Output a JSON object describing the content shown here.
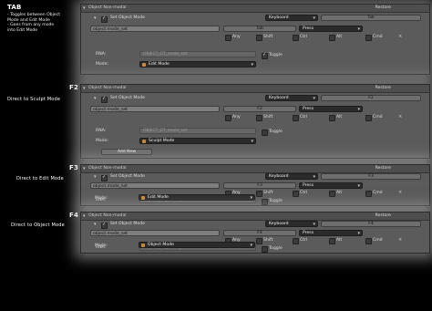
{
  "sections": [
    {
      "title": "TAB",
      "description": [
        "- Toggles between Object",
        "  Mode and Edit Mode",
        "- Goes from any mode",
        "  into Edit Mode"
      ],
      "km_title": "Object Non-modal",
      "restore": "Restore",
      "item_name": "Set Object Mode",
      "input_type": "Keyboard",
      "key": "Tab",
      "operator": "object.mode_set",
      "key_field": "Tab",
      "event": "Press",
      "modifiers": [
        "Any",
        "Shift",
        "Ctrl",
        "Alt",
        "Cmd"
      ],
      "rna_label": "RNA:",
      "rna_value": "OBJECT_OT_mode_set",
      "mode_label": "Mode:",
      "mode_value": "Edit Mode",
      "toggle_label": "Toggle",
      "toggle_checked": true,
      "add_new": ""
    },
    {
      "title": "F2",
      "subtitle": "Direct to Sculpt Mode",
      "km_title": "Object Non-modal",
      "restore": "Restore",
      "item_name": "Set Object Mode",
      "input_type": "Keyboard",
      "key": "F2",
      "operator": "object.mode_set",
      "key_field": "F2",
      "event": "Press",
      "modifiers": [
        "Any",
        "Shift",
        "Ctrl",
        "Alt",
        "Cmd"
      ],
      "rna_label": "RNA:",
      "rna_value": "OBJECT_OT_mode_set",
      "mode_label": "Mode:",
      "mode_value": "Sculpt Mode",
      "toggle_label": "Toggle",
      "toggle_checked": false,
      "add_new": "Add New"
    },
    {
      "title": "F3",
      "subtitle": "Direct to Edit Mode",
      "km_title": "Object Non-modal",
      "restore": "Restore",
      "item_name": "Set Object Mode",
      "input_type": "Keyboard",
      "key": "F3",
      "operator": "object.mode_set",
      "key_field": "F3",
      "event": "Press",
      "modifiers": [
        "Any",
        "Shift",
        "Ctrl",
        "Alt",
        "Cmd"
      ],
      "rna_label": "RNA:",
      "rna_value": "OBJECT_OT_mode_set",
      "mode_label": "Mode:",
      "mode_value": "Edit Mode",
      "toggle_label": "Toggle",
      "toggle_checked": false,
      "add_new": ""
    },
    {
      "title": "F4",
      "subtitle": "Direct to Object Mode",
      "km_title": "Object Non-modal",
      "restore": "Restore",
      "item_name": "Set Object Mode",
      "input_type": "Keyboard",
      "key": "F4",
      "operator": "object.mode_set",
      "key_field": "F4",
      "event": "Press",
      "modifiers": [
        "Any",
        "Shift",
        "Ctrl",
        "Alt",
        "Cmd"
      ],
      "rna_label": "RNA:",
      "rna_value": "OBJECT_OT_mode_set",
      "mode_label": "Mode:",
      "mode_value": "Object Mode",
      "toggle_label": "Toggle",
      "toggle_checked": false,
      "add_new": ""
    }
  ]
}
